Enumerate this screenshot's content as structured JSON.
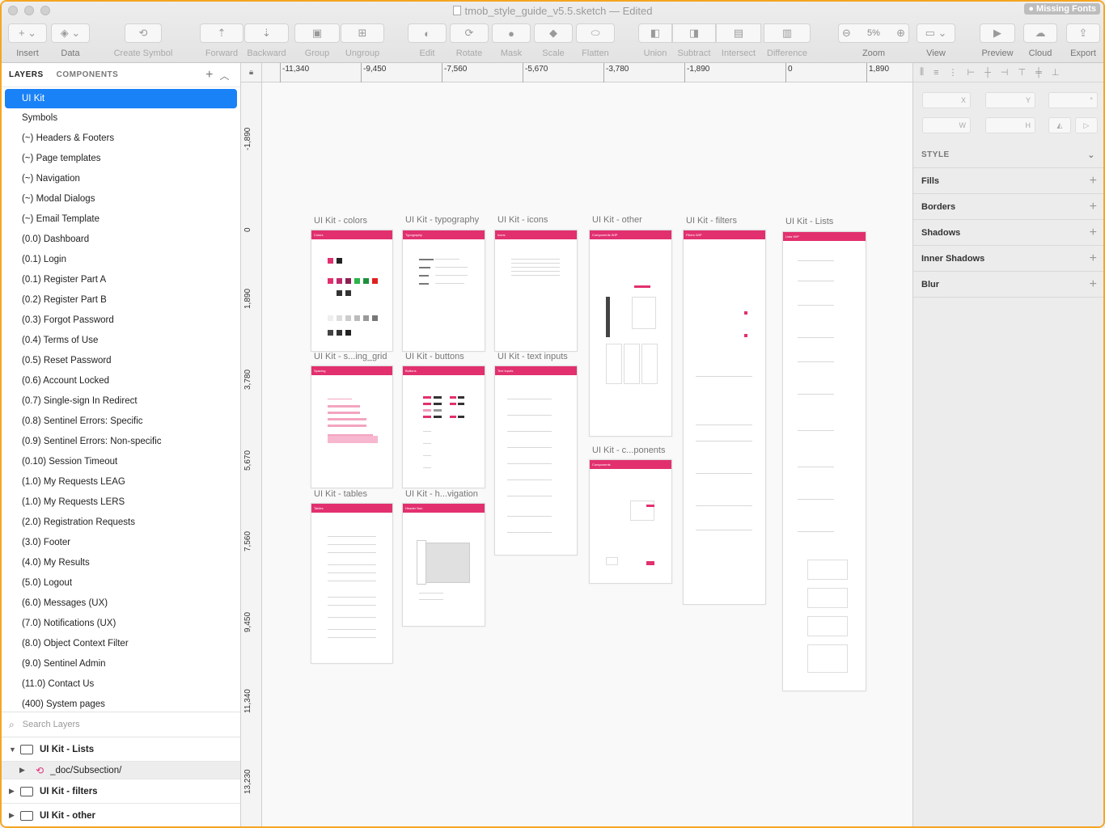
{
  "window": {
    "title": "tmob_style_guide_v5.5.sketch",
    "status": "— Edited",
    "missing_fonts": "● Missing Fonts"
  },
  "toolbar": {
    "insert": "Insert",
    "data": "Data",
    "create_symbol": "Create Symbol",
    "forward": "Forward",
    "backward": "Backward",
    "group": "Group",
    "ungroup": "Ungroup",
    "edit": "Edit",
    "rotate": "Rotate",
    "mask": "Mask",
    "scale": "Scale",
    "flatten": "Flatten",
    "union": "Union",
    "subtract": "Subtract",
    "intersect": "Intersect",
    "difference": "Difference",
    "zoom": "Zoom",
    "zoom_value": "5%",
    "view": "View",
    "preview": "Preview",
    "cloud": "Cloud",
    "export": "Export"
  },
  "left_panel": {
    "tab_layers": "LAYERS",
    "tab_components": "COMPONENTS",
    "pages": [
      "UI Kit",
      "Symbols",
      "(~) Headers & Footers",
      "(~) Page templates",
      "(~) Navigation",
      "(~) Modal Dialogs",
      "(~) Email Template",
      "(0.0) Dashboard",
      "(0.1) Login",
      "(0.1) Register Part A",
      "(0.2) Register Part B",
      "(0.3) Forgot Password",
      "(0.4) Terms of Use",
      "(0.5) Reset Password",
      "(0.6) Account Locked",
      "(0.7) Single-sign In Redirect",
      "(0.8) Sentinel Errors: Specific",
      "(0.9) Sentinel Errors: Non-specific",
      "(0.10) Session Timeout",
      "(1.0) My Requests LEAG",
      "(1.0) My Requests LERS",
      "(2.0) Registration Requests",
      "(3.0) Footer",
      "(4.0) My Results",
      "(5.0) Logout",
      "(6.0) Messages (UX)",
      "(7.0) Notifications (UX)",
      "(8.0) Object Context Filter",
      "(9.0) Sentinel Admin",
      "(11.0) Contact Us",
      "(400) System pages"
    ],
    "search_placeholder": "Search Layers",
    "layers": [
      {
        "name": "UI Kit - Lists"
      },
      {
        "name": "_doc/Subsection/"
      },
      {
        "name": "UI Kit - filters"
      },
      {
        "name": "UI Kit - other"
      }
    ]
  },
  "rulers": {
    "top": [
      "-11,340",
      "-9,450",
      "-7,560",
      "-5,670",
      "-3,780",
      "-1,890",
      "0",
      "1,890"
    ],
    "left": [
      "-1,890",
      "0",
      "1,890",
      "3,780",
      "5,670",
      "7,560",
      "9,450",
      "11,340",
      "13,230"
    ]
  },
  "artboards": [
    {
      "title": "UI Kit - colors",
      "header": "Colors"
    },
    {
      "title": "UI Kit - typography",
      "header": "Typography"
    },
    {
      "title": "UI Kit - icons",
      "header": "Icons"
    },
    {
      "title": "UI Kit - other",
      "header": "Components WIP"
    },
    {
      "title": "UI Kit - filters",
      "header": "Filters WIP"
    },
    {
      "title": "UI Kit - Lists",
      "header": "Lists WIP"
    },
    {
      "title": "UI Kit - s...ing_grid",
      "header": "Spacing"
    },
    {
      "title": "UI Kit - buttons",
      "header": "Buttons"
    },
    {
      "title": "UI Kit - text inputs",
      "header": "Text Inputs"
    },
    {
      "title": "UI Kit - c...ponents",
      "header": "Components"
    },
    {
      "title": "UI Kit - tables",
      "header": "Tables"
    },
    {
      "title": "UI Kit - h...vigation",
      "header": "Header Nav"
    }
  ],
  "right_panel": {
    "x_label": "X",
    "y_label": "Y",
    "w_label": "W",
    "h_label": "H",
    "rotation_label": "°",
    "style": "STYLE",
    "fills": "Fills",
    "borders": "Borders",
    "shadows": "Shadows",
    "inner_shadows": "Inner Shadows",
    "blur": "Blur"
  },
  "colors": {
    "accent": "#e2306f",
    "selection": "#1a82f7",
    "window_border": "#f5a623"
  }
}
